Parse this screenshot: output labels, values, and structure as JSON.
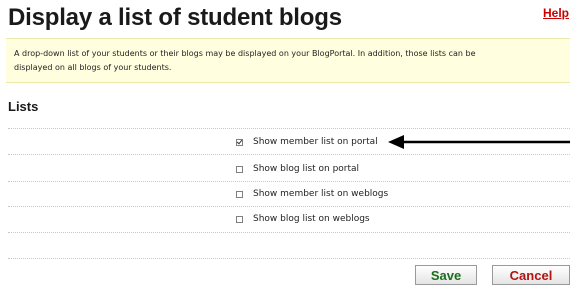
{
  "header": {
    "title": "Display a list of student blogs",
    "help_label": "Help"
  },
  "info": {
    "line1": "A drop-down list of your students or their blogs may be displayed on your BlogPortal. In addition, those lists can be",
    "line2": "displayed on all blogs of your students."
  },
  "lists": {
    "title": "Lists",
    "options": [
      {
        "label": "Show member list on portal",
        "checked": true
      },
      {
        "label": "Show blog list on portal",
        "checked": false
      },
      {
        "label": "Show member list on weblogs",
        "checked": false
      },
      {
        "label": "Show blog list on weblogs",
        "checked": false
      }
    ]
  },
  "actions": {
    "save_label": "Save",
    "cancel_label": "Cancel"
  },
  "colors": {
    "info_background": "#ffffe0",
    "help": "#cc0000",
    "save": "#1b6e1b",
    "cancel": "#b31212"
  }
}
